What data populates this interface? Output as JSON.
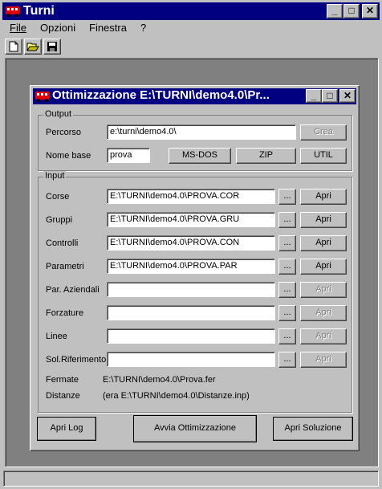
{
  "app": {
    "title": "Turni",
    "caption_buttons": {
      "minimize": "_",
      "maximize": "□",
      "close": "✕"
    }
  },
  "menu": {
    "file": "File",
    "options": "Opzioni",
    "window": "Finestra",
    "help": "?"
  },
  "toolbar": {
    "icons": [
      "new-document-icon",
      "open-folder-icon",
      "save-disk-icon"
    ]
  },
  "dialog": {
    "title": "Ottimizzazione E:\\TURNI\\demo4.0\\Pr...",
    "output": {
      "legend": "Output",
      "path_label": "Percorso",
      "path_value": "e:\\turni\\demo4.0\\",
      "create_button": "Crea",
      "base_name_label": "Nome base",
      "base_name_value": "prova",
      "msdos_button": "MS-DOS",
      "zip_button": "ZIP",
      "util_button": "UTIL"
    },
    "input": {
      "legend": "Input",
      "rows": [
        {
          "label": "Corse",
          "value": "E:\\TURNI\\demo4.0\\PROVA.COR",
          "browse": "...",
          "open": "Apri",
          "enabled": true
        },
        {
          "label": "Gruppi",
          "value": "E:\\TURNI\\demo4.0\\PROVA.GRU",
          "browse": "...",
          "open": "Apri",
          "enabled": true
        },
        {
          "label": "Controlli",
          "value": "E:\\TURNI\\demo4.0\\PROVA.CON",
          "browse": "...",
          "open": "Apri",
          "enabled": true
        },
        {
          "label": "Parametri",
          "value": "E:\\TURNI\\demo4.0\\PROVA.PAR",
          "browse": "...",
          "open": "Apri",
          "enabled": true
        },
        {
          "label": "Par. Aziendali",
          "value": "",
          "browse": "...",
          "open": "Apri",
          "enabled": false
        },
        {
          "label": "Forzature",
          "value": "",
          "browse": "...",
          "open": "Apri",
          "enabled": false
        },
        {
          "label": "Linee",
          "value": "",
          "browse": "...",
          "open": "Apri",
          "enabled": false
        },
        {
          "label": "Sol.Riferimento",
          "value": "",
          "browse": "...",
          "open": "Apri",
          "enabled": false
        }
      ],
      "stops_label": "Fermate",
      "stops_value": "E:\\TURNI\\demo4.0\\Prova.fer",
      "distances_label": "Distanze",
      "distances_value": "(era E:\\TURNI\\demo4.0\\Distanze.inp)"
    },
    "buttons": {
      "open_log": "Apri Log",
      "start": "Avvia Ottimizzazione",
      "open_solution": "Apri Soluzione"
    }
  },
  "colors": {
    "face": "#c0c0c0",
    "titlebar": "#000080",
    "mdi_background": "#808080",
    "icon_red": "#e00000"
  }
}
